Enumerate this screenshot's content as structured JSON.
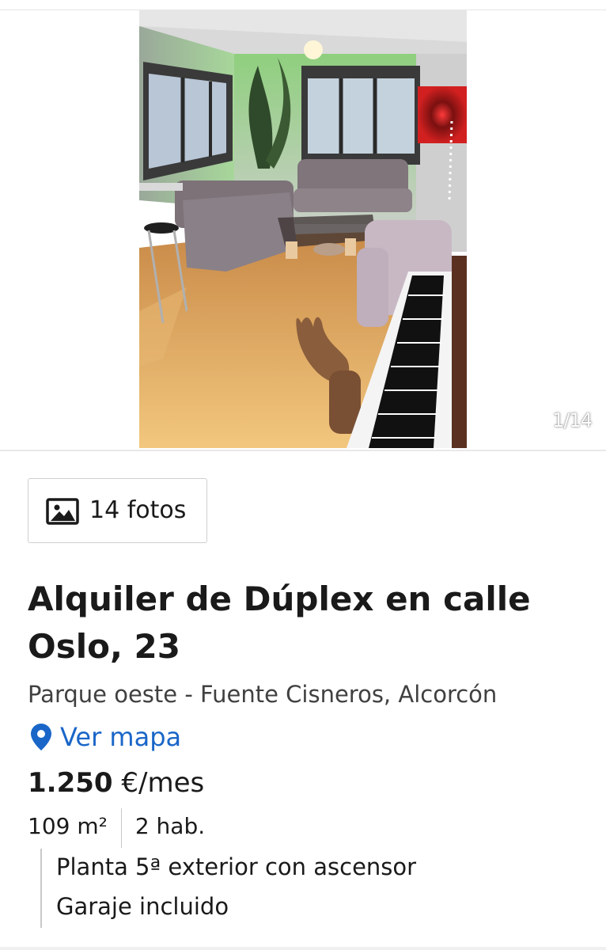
{
  "gallery": {
    "current": 1,
    "total": 14,
    "counter_text": "1/14",
    "photo_label": "living room photo"
  },
  "photos_button": {
    "label": "14 fotos",
    "icon": "image-icon"
  },
  "listing": {
    "title": "Alquiler de Dúplex en calle Oslo, 23",
    "location": "Parque oeste - Fuente Cisneros, Alcorcón",
    "map_link": "Ver mapa",
    "price_amount": "1.250",
    "price_unit": "€/mes",
    "area": "109 m²",
    "rooms": "2 hab.",
    "details": [
      "Planta 5ª exterior con ascensor",
      "Garaje incluido"
    ]
  },
  "colors": {
    "link": "#1a66c8",
    "text": "#1a1a1a",
    "muted": "#404040"
  }
}
